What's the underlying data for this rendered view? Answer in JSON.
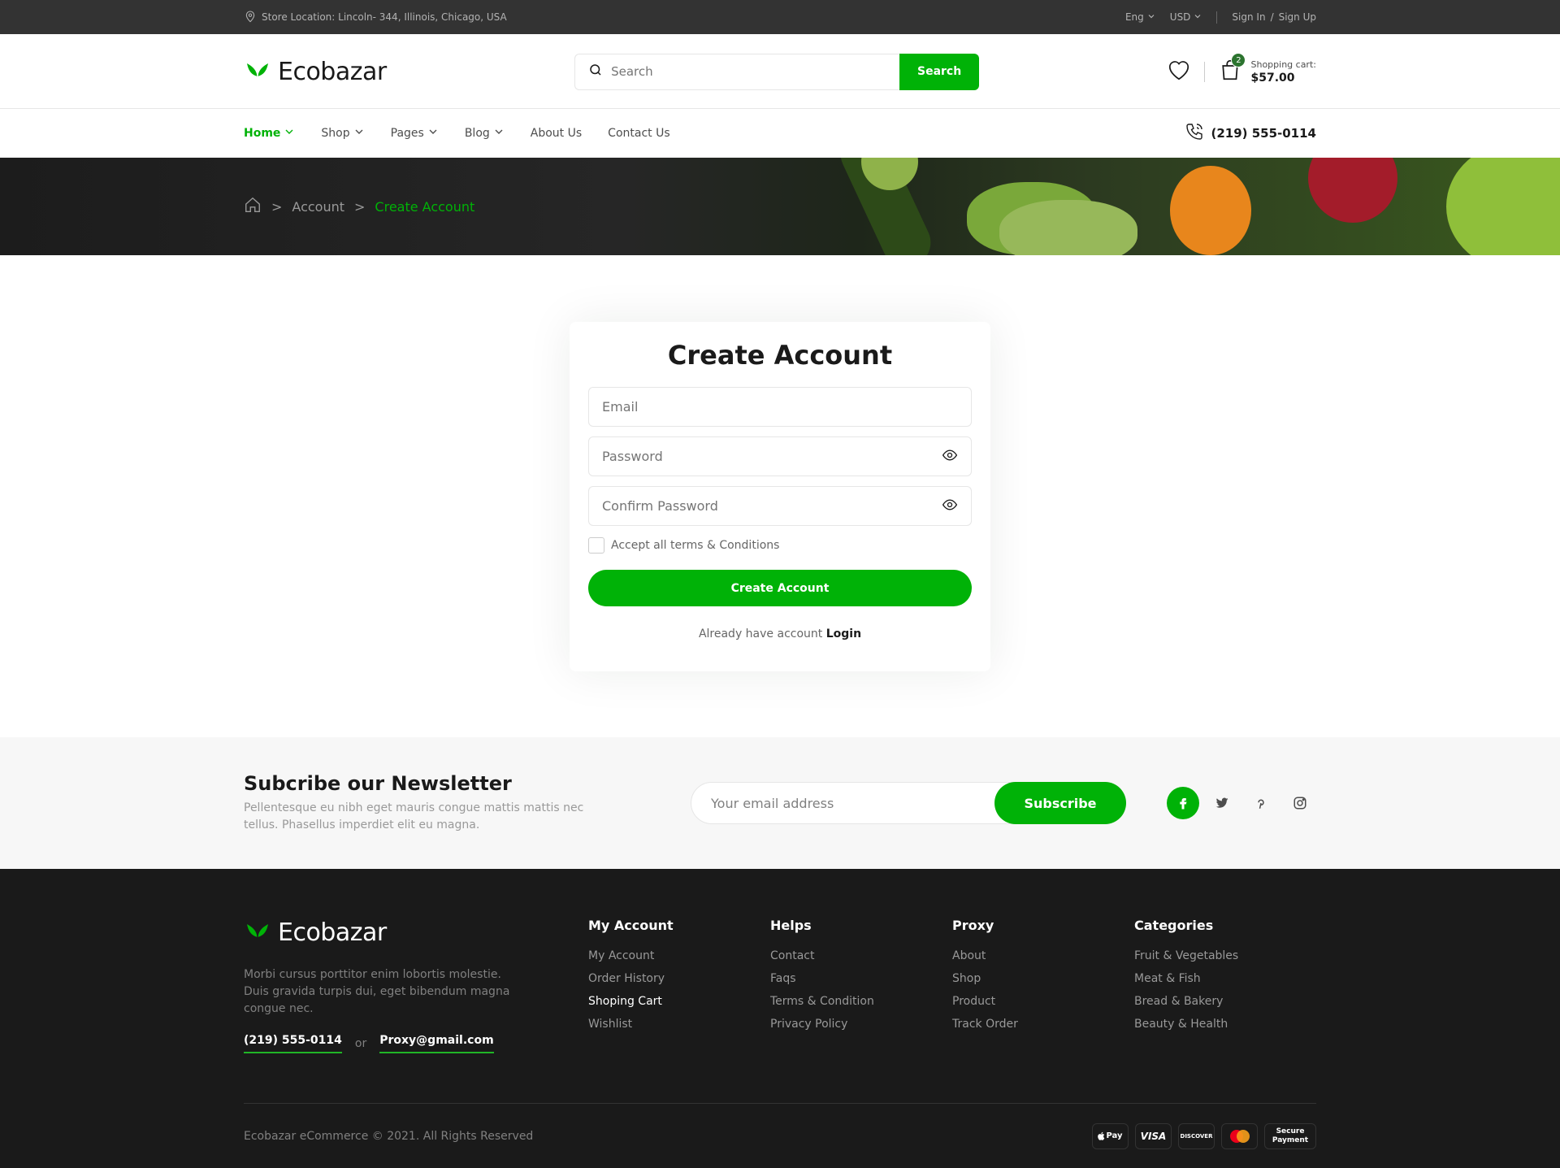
{
  "topbar": {
    "location": "Store Location: Lincoln- 344, Illinois, Chicago, USA",
    "language": "Eng",
    "currency": "USD",
    "sign_in": "Sign In",
    "slash": "/",
    "sign_up": "Sign Up"
  },
  "header": {
    "brand": "Ecobazar",
    "search_placeholder": "Search",
    "search_button": "Search",
    "cart_count": "2",
    "cart_label": "Shopping cart:",
    "cart_total": "$57.00"
  },
  "nav": {
    "items": [
      {
        "label": "Home",
        "active": true,
        "dropdown": true
      },
      {
        "label": "Shop",
        "dropdown": true
      },
      {
        "label": "Pages",
        "dropdown": true
      },
      {
        "label": "Blog",
        "dropdown": true
      },
      {
        "label": "About Us"
      },
      {
        "label": "Contact Us"
      }
    ],
    "phone": "(219) 555-0114"
  },
  "breadcrumb": {
    "items": [
      "Account",
      "Create Account"
    ],
    "separator": ">"
  },
  "form": {
    "title": "Create Account",
    "email_placeholder": "Email",
    "password_placeholder": "Password",
    "confirm_placeholder": "Confirm Password",
    "terms": "Accept all terms & Conditions",
    "submit": "Create Account",
    "already_text": "Already have account",
    "login_link": "Login"
  },
  "newsletter": {
    "title": "Subcribe our Newsletter",
    "description": "Pellentesque eu nibh eget mauris congue mattis mattis nec tellus. Phasellus imperdiet elit eu magna.",
    "email_placeholder": "Your email address",
    "button": "Subscribe",
    "socials": [
      "facebook-icon",
      "twitter-icon",
      "pinterest-icon",
      "instagram-icon"
    ]
  },
  "footer": {
    "brand": "Ecobazar",
    "description": "Morbi cursus porttitor enim lobortis molestie. Duis gravida turpis dui, eget bibendum magna congue nec.",
    "phone": "(219) 555-0114",
    "or": "or",
    "email": "Proxy@gmail.com",
    "columns": [
      {
        "title": "My Account",
        "links": [
          "My Account",
          "Order History",
          "Shoping Cart",
          "Wishlist"
        ]
      },
      {
        "title": "Helps",
        "links": [
          "Contact",
          "Faqs",
          "Terms & Condition",
          "Privacy Policy"
        ]
      },
      {
        "title": "Proxy",
        "links": [
          "About",
          "Shop",
          "Product",
          "Track Order"
        ]
      },
      {
        "title": "Categories",
        "links": [
          "Fruit & Vegetables",
          "Meat & Fish",
          "Bread & Bakery",
          "Beauty & Health"
        ]
      }
    ],
    "copyright": "Ecobazar eCommerce © 2021. All Rights Reserved",
    "payments": {
      "applepay": "Pay",
      "visa": "VISA",
      "discover": "DISCOVER",
      "secure_top": "Secure",
      "secure_bottom": "Payment"
    }
  },
  "colors": {
    "primary": "#00b207",
    "dark_green": "#2c742f",
    "topbar": "#333333",
    "footer": "#1a1a1a"
  }
}
